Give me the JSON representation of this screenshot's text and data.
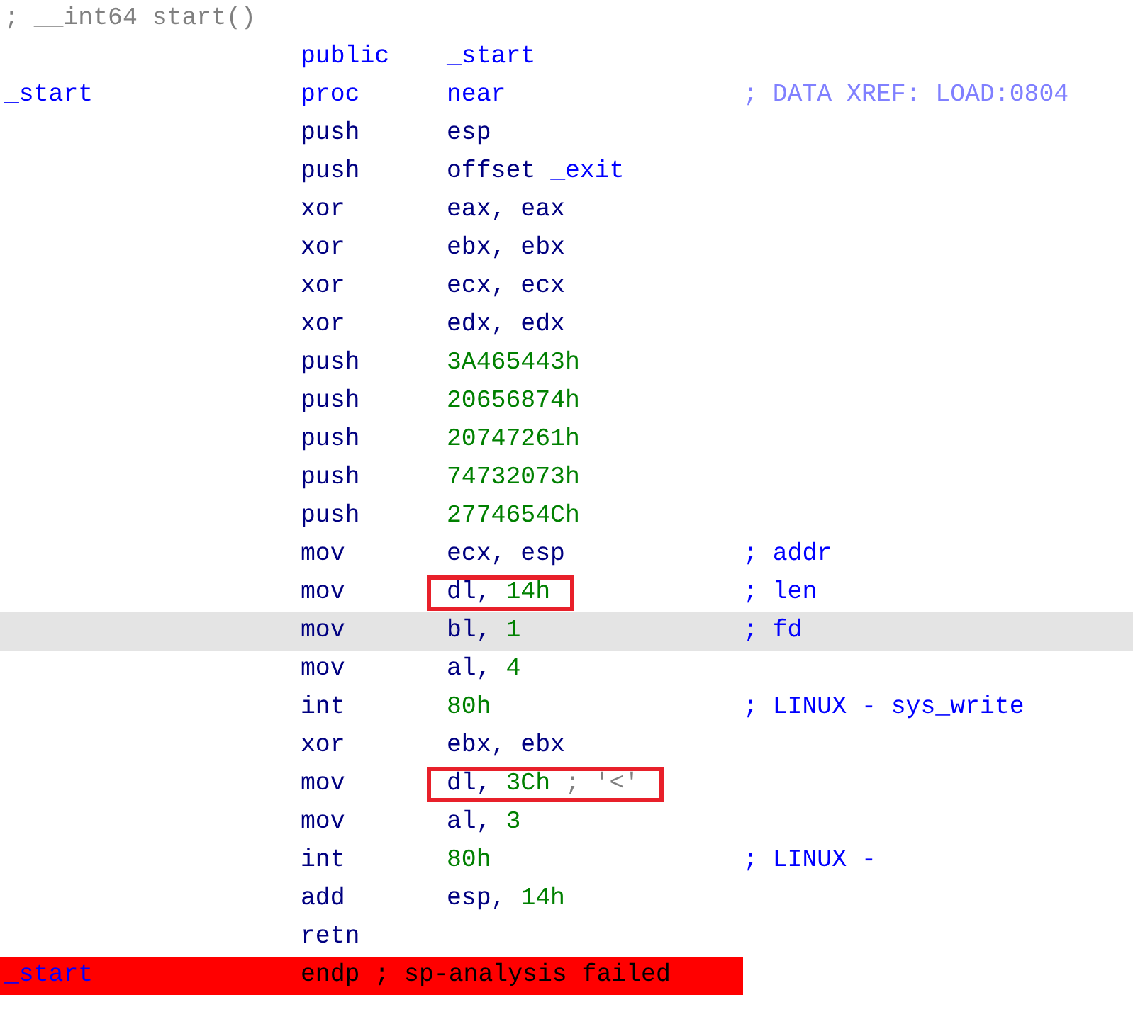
{
  "lines": [
    {
      "kind": "header",
      "text": "; __int64 start()",
      "selected": false,
      "error": false
    },
    {
      "kind": "code",
      "op": {
        "text": "public",
        "kind": "directive"
      },
      "operands": [
        {
          "text": "_start",
          "kind": "name"
        }
      ],
      "selected": false,
      "error": false,
      "boxed": false
    },
    {
      "kind": "code",
      "label": "_start",
      "op": {
        "text": "proc",
        "kind": "directive"
      },
      "operands": [
        {
          "text": "near",
          "kind": "name"
        }
      ],
      "comment": {
        "text": "; DATA XREF: LOAD:0804",
        "kind": "xref"
      },
      "selected": false,
      "error": false,
      "boxed": false
    },
    {
      "kind": "code",
      "op": {
        "text": "push",
        "kind": "instr"
      },
      "operands": [
        {
          "text": "esp",
          "kind": "reg"
        }
      ],
      "selected": false,
      "error": false,
      "boxed": false
    },
    {
      "kind": "code",
      "op": {
        "text": "push",
        "kind": "instr"
      },
      "operands": [
        {
          "text": "offset ",
          "kind": "reg"
        },
        {
          "text": "_exit",
          "kind": "name"
        }
      ],
      "selected": false,
      "error": false,
      "boxed": false
    },
    {
      "kind": "code",
      "op": {
        "text": "xor",
        "kind": "instr"
      },
      "operands": [
        {
          "text": "eax, eax",
          "kind": "reg"
        }
      ],
      "selected": false,
      "error": false,
      "boxed": false
    },
    {
      "kind": "code",
      "op": {
        "text": "xor",
        "kind": "instr"
      },
      "operands": [
        {
          "text": "ebx, ebx",
          "kind": "reg"
        }
      ],
      "selected": false,
      "error": false,
      "boxed": false
    },
    {
      "kind": "code",
      "op": {
        "text": "xor",
        "kind": "instr"
      },
      "operands": [
        {
          "text": "ecx, ecx",
          "kind": "reg"
        }
      ],
      "selected": false,
      "error": false,
      "boxed": false
    },
    {
      "kind": "code",
      "op": {
        "text": "xor",
        "kind": "instr"
      },
      "operands": [
        {
          "text": "edx, edx",
          "kind": "reg"
        }
      ],
      "selected": false,
      "error": false,
      "boxed": false
    },
    {
      "kind": "code",
      "op": {
        "text": "push",
        "kind": "instr"
      },
      "operands": [
        {
          "text": "3A465443h",
          "kind": "num"
        }
      ],
      "selected": false,
      "error": false,
      "boxed": false
    },
    {
      "kind": "code",
      "op": {
        "text": "push",
        "kind": "instr"
      },
      "operands": [
        {
          "text": "20656874h",
          "kind": "num"
        }
      ],
      "selected": false,
      "error": false,
      "boxed": false
    },
    {
      "kind": "code",
      "op": {
        "text": "push",
        "kind": "instr"
      },
      "operands": [
        {
          "text": "20747261h",
          "kind": "num"
        }
      ],
      "selected": false,
      "error": false,
      "boxed": false
    },
    {
      "kind": "code",
      "op": {
        "text": "push",
        "kind": "instr"
      },
      "operands": [
        {
          "text": "74732073h",
          "kind": "num"
        }
      ],
      "selected": false,
      "error": false,
      "boxed": false
    },
    {
      "kind": "code",
      "op": {
        "text": "push",
        "kind": "instr"
      },
      "operands": [
        {
          "text": "2774654Ch",
          "kind": "num"
        }
      ],
      "selected": false,
      "error": false,
      "boxed": false
    },
    {
      "kind": "code",
      "op": {
        "text": "mov",
        "kind": "instr"
      },
      "operands": [
        {
          "text": "ecx, esp",
          "kind": "reg"
        }
      ],
      "comment": {
        "text": "; addr",
        "kind": "auto"
      },
      "selected": false,
      "error": false,
      "boxed": false
    },
    {
      "kind": "code",
      "op": {
        "text": "mov",
        "kind": "instr"
      },
      "operands": [
        {
          "text": "dl, ",
          "kind": "reg"
        },
        {
          "text": "14h",
          "kind": "num"
        }
      ],
      "comment": {
        "text": "; len",
        "kind": "auto"
      },
      "selected": false,
      "error": false,
      "boxed": true
    },
    {
      "kind": "code",
      "op": {
        "text": "mov",
        "kind": "instr"
      },
      "operands": [
        {
          "text": "bl, ",
          "kind": "reg"
        },
        {
          "text": "1",
          "kind": "num"
        }
      ],
      "comment": {
        "text": "; fd",
        "kind": "auto"
      },
      "selected": true,
      "error": false,
      "boxed": false
    },
    {
      "kind": "code",
      "op": {
        "text": "mov",
        "kind": "instr"
      },
      "operands": [
        {
          "text": "al, ",
          "kind": "reg"
        },
        {
          "text": "4",
          "kind": "num"
        }
      ],
      "selected": false,
      "error": false,
      "boxed": false
    },
    {
      "kind": "code",
      "op": {
        "text": "int",
        "kind": "instr"
      },
      "operands": [
        {
          "text": "80h",
          "kind": "num"
        }
      ],
      "comment": {
        "text": "; LINUX - sys_write",
        "kind": "auto"
      },
      "selected": false,
      "error": false,
      "boxed": false
    },
    {
      "kind": "code",
      "op": {
        "text": "xor",
        "kind": "instr"
      },
      "operands": [
        {
          "text": "ebx, ebx",
          "kind": "reg"
        }
      ],
      "selected": false,
      "error": false,
      "boxed": false
    },
    {
      "kind": "code",
      "op": {
        "text": "mov",
        "kind": "instr"
      },
      "operands": [
        {
          "text": "dl, ",
          "kind": "reg"
        },
        {
          "text": "3Ch",
          "kind": "num"
        },
        {
          "text": " ; '<'",
          "kind": "char"
        }
      ],
      "selected": false,
      "error": false,
      "boxed": true
    },
    {
      "kind": "code",
      "op": {
        "text": "mov",
        "kind": "instr"
      },
      "operands": [
        {
          "text": "al, ",
          "kind": "reg"
        },
        {
          "text": "3",
          "kind": "num"
        }
      ],
      "selected": false,
      "error": false,
      "boxed": false
    },
    {
      "kind": "code",
      "op": {
        "text": "int",
        "kind": "instr"
      },
      "operands": [
        {
          "text": "80h",
          "kind": "num"
        }
      ],
      "comment": {
        "text": "; LINUX -",
        "kind": "auto"
      },
      "selected": false,
      "error": false,
      "boxed": false
    },
    {
      "kind": "code",
      "op": {
        "text": "add",
        "kind": "instr"
      },
      "operands": [
        {
          "text": "esp, ",
          "kind": "reg"
        },
        {
          "text": "14h",
          "kind": "num"
        }
      ],
      "selected": false,
      "error": false,
      "boxed": false
    },
    {
      "kind": "code",
      "op": {
        "text": "retn",
        "kind": "instr"
      },
      "selected": false,
      "error": false
    },
    {
      "kind": "code",
      "label": "_start",
      "op": {
        "text": "endp ; sp-analysis failed",
        "kind": "instr"
      },
      "selected": false,
      "error": true
    }
  ]
}
